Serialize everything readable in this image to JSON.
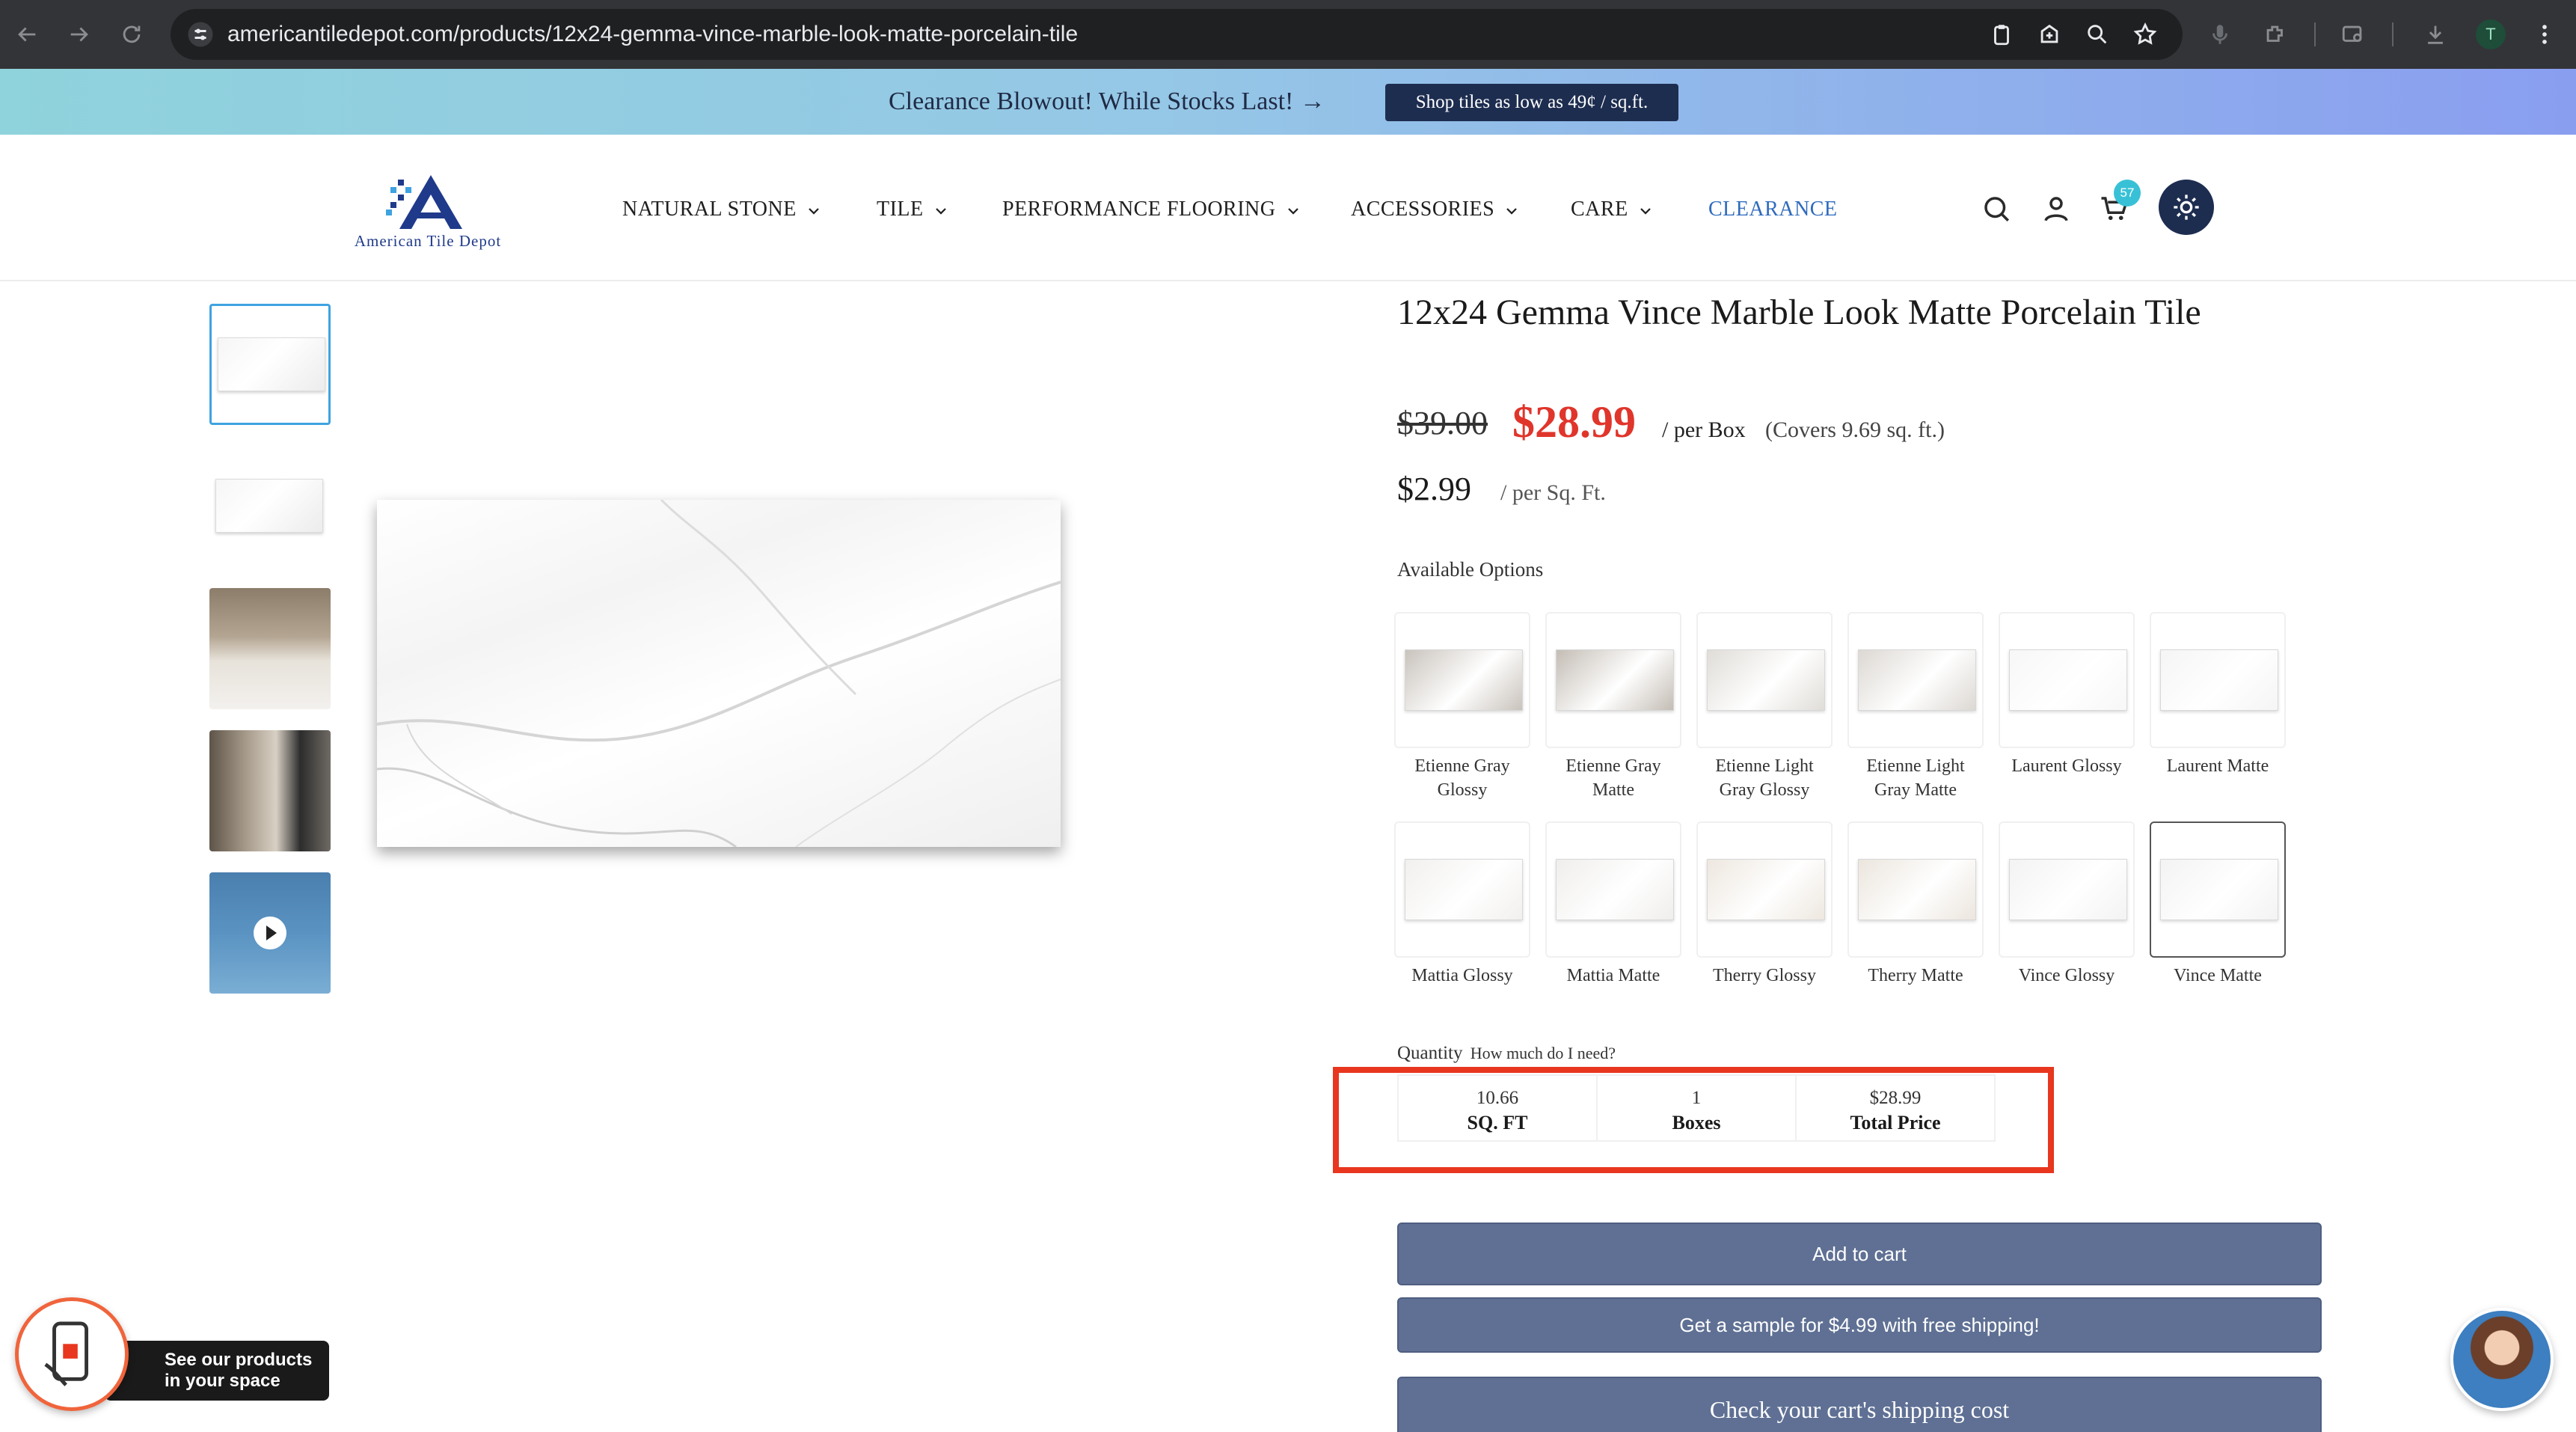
{
  "browser": {
    "url": "americantiledepot.com/products/12x24-gemma-vince-marble-look-matte-porcelain-tile",
    "profile_initial": "T"
  },
  "promo": {
    "text": "Clearance Blowout! While Stocks Last! →",
    "button": "Shop tiles as low as 49¢ / sq.ft."
  },
  "header": {
    "logo_text": "American Tile Depot",
    "nav": [
      "NATURAL STONE",
      "TILE",
      "PERFORMANCE FLOORING",
      "ACCESSORIES",
      "CARE",
      "CLEARANCE"
    ],
    "cart_count": "57"
  },
  "product": {
    "title": "12x24 Gemma Vince Marble Look Matte Porcelain Tile",
    "old_price": "$39.00",
    "new_price": "$28.99",
    "per_box": "/ per Box",
    "covers": "(Covers 9.69 sq. ft.)",
    "sqft_price": "$2.99",
    "sqft_unit": "/ per Sq. Ft.",
    "available_label": "Available Options",
    "options": [
      {
        "label": "Etienne Gray Glossy",
        "color": "#c9c3bc"
      },
      {
        "label": "Etienne Gray Matte",
        "color": "#c4bdb5"
      },
      {
        "label": "Etienne Light Gray Glossy",
        "color": "#e0ddd8"
      },
      {
        "label": "Etienne Light Gray Matte",
        "color": "#dcd8d3"
      },
      {
        "label": "Laurent Glossy",
        "color": "#f7f7f7"
      },
      {
        "label": "Laurent Matte",
        "color": "#f5f5f5"
      },
      {
        "label": "Mattia Glossy",
        "color": "#f2f0ee"
      },
      {
        "label": "Mattia Matte",
        "color": "#f0eeec"
      },
      {
        "label": "Therry Glossy",
        "color": "#ede7df"
      },
      {
        "label": "Therry Matte",
        "color": "#ebe5dd"
      },
      {
        "label": "Vince Glossy",
        "color": "#f3f3f3"
      },
      {
        "label": "Vince Matte",
        "color": "#f3f3f3"
      }
    ],
    "selected_option": "Vince Matte"
  },
  "quantity": {
    "label": "Quantity",
    "help": "How much do I need?",
    "sqft_value": "10.66",
    "sqft_label": "SQ. FT",
    "boxes_value": "1",
    "boxes_label": "Boxes",
    "total_value": "$28.99",
    "total_label": "Total Price"
  },
  "buttons": {
    "add_to_cart": "Add to cart",
    "sample": "Get a sample for $4.99 with free shipping!",
    "shipping": "Check your cart's shipping cost"
  },
  "widgets": {
    "ar_text_line1": "See our products",
    "ar_text_line2": "in your space"
  },
  "colors": {
    "accent_red": "#e0352b",
    "highlight_border": "#e8361f",
    "button_bg": "#5f7094",
    "navy": "#1d2d50"
  }
}
